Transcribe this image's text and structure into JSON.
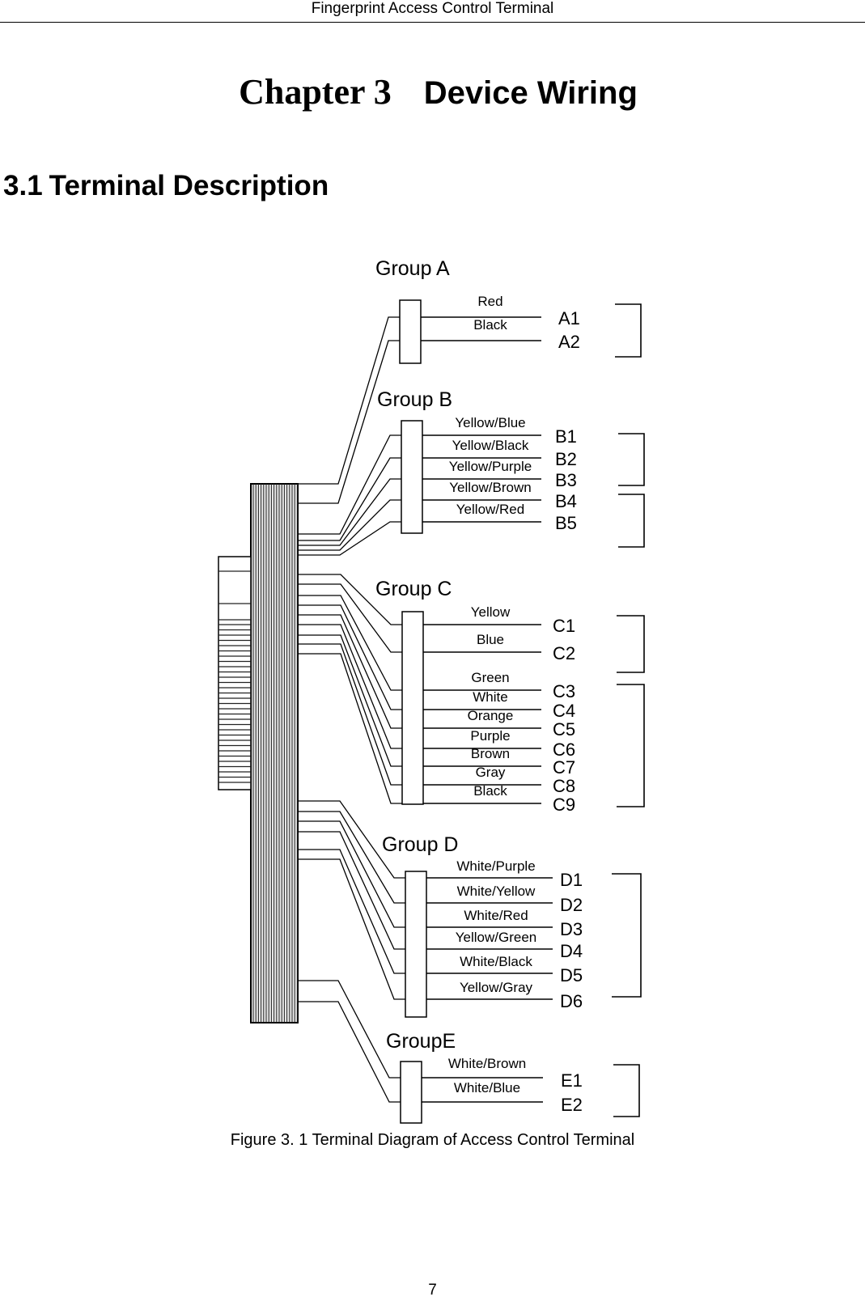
{
  "header": {
    "running_title": "Fingerprint Access Control Terminal"
  },
  "chapter": {
    "number": "Chapter 3",
    "title": "Device Wiring"
  },
  "section": {
    "number": "3.1",
    "title": "Terminal Description"
  },
  "figure": {
    "caption": "Figure 3. 1 Terminal Diagram of Access Control Terminal",
    "groups": [
      {
        "name": "Group A",
        "wires": [
          {
            "terminal": "A1",
            "color": "Red"
          },
          {
            "terminal": "A2",
            "color": "Black"
          }
        ],
        "brackets": [
          [
            "A1",
            "A2"
          ]
        ]
      },
      {
        "name": "Group B",
        "wires": [
          {
            "terminal": "B1",
            "color": "Yellow/Blue"
          },
          {
            "terminal": "B2",
            "color": "Yellow/Black"
          },
          {
            "terminal": "B3",
            "color": "Yellow/Purple"
          },
          {
            "terminal": "B4",
            "color": "Yellow/Brown"
          },
          {
            "terminal": "B5",
            "color": "Yellow/Red"
          }
        ],
        "brackets": [
          [
            "B1",
            "B3"
          ],
          [
            "B4",
            "B5"
          ]
        ]
      },
      {
        "name": "Group C",
        "wires": [
          {
            "terminal": "C1",
            "color": "Yellow"
          },
          {
            "terminal": "C2",
            "color": "Blue"
          },
          {
            "terminal": "C3",
            "color": "Green"
          },
          {
            "terminal": "C4",
            "color": "White"
          },
          {
            "terminal": "C5",
            "color": "Orange"
          },
          {
            "terminal": "C6",
            "color": "Purple"
          },
          {
            "terminal": "C7",
            "color": "Brown"
          },
          {
            "terminal": "C8",
            "color": "Gray"
          },
          {
            "terminal": "C9",
            "color": "Black"
          }
        ],
        "brackets": [
          [
            "C1",
            "C2"
          ],
          [
            "C3",
            "C9"
          ]
        ]
      },
      {
        "name": "Group D",
        "wires": [
          {
            "terminal": "D1",
            "color": "White/Purple"
          },
          {
            "terminal": "D2",
            "color": "White/Yellow"
          },
          {
            "terminal": "D3",
            "color": "White/Red"
          },
          {
            "terminal": "D4",
            "color": "Yellow/Green"
          },
          {
            "terminal": "D5",
            "color": "White/Black"
          },
          {
            "terminal": "D6",
            "color": "Yellow/Gray"
          }
        ],
        "brackets": [
          [
            "D1",
            "D6"
          ]
        ]
      },
      {
        "name": "GroupE",
        "wires": [
          {
            "terminal": "E1",
            "color": "White/Brown"
          },
          {
            "terminal": "E2",
            "color": "White/Blue"
          }
        ],
        "brackets": [
          [
            "E1",
            "E2"
          ]
        ]
      }
    ]
  },
  "footer": {
    "page_number": "7"
  }
}
